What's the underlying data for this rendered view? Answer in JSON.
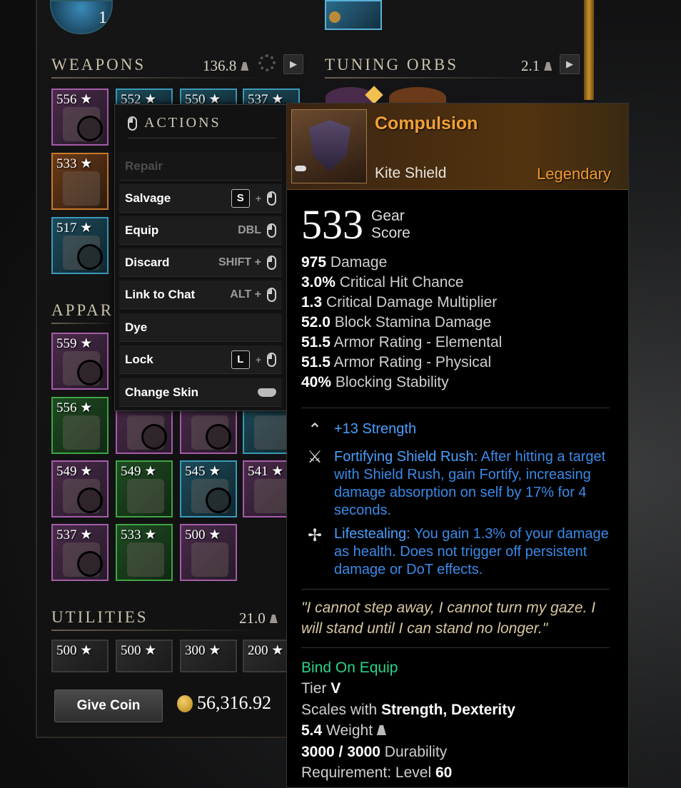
{
  "top": {
    "potion_count": "1"
  },
  "sections": {
    "weapons": {
      "title": "WEAPONS",
      "weight": "136.8"
    },
    "tuning_orbs": {
      "title": "TUNING ORBS",
      "weight": "2.1"
    },
    "apparel": {
      "title": "APPAR"
    },
    "utilities": {
      "title": "UTILITIES",
      "weight": "21.0"
    }
  },
  "weapon_tiles": [
    "556",
    "552",
    "550",
    "537",
    "533",
    "517"
  ],
  "apparel_tiles": [
    "559",
    "556",
    "549",
    "549",
    "545",
    "541",
    "537",
    "533",
    "500"
  ],
  "utility_tiles": [
    "500",
    "500",
    "300",
    "200"
  ],
  "give_coin": "Give Coin",
  "coins": "56,316.92",
  "actions": {
    "title": "ACTIONS",
    "items": [
      {
        "label": "Repair",
        "hint": ""
      },
      {
        "label": "Salvage",
        "key": "S"
      },
      {
        "label": "Equip",
        "hint": "DBL"
      },
      {
        "label": "Discard",
        "hint": "SHIFT +"
      },
      {
        "label": "Link to Chat",
        "hint": "ALT +"
      },
      {
        "label": "Dye",
        "hint": ""
      },
      {
        "label": "Lock",
        "key": "L"
      },
      {
        "label": "Change Skin",
        "hint": ""
      }
    ]
  },
  "tooltip": {
    "name": "Compulsion",
    "type": "Kite Shield",
    "rarity": "Legendary",
    "gear_score": "533",
    "gear_score_label": [
      "Gear",
      "Score"
    ],
    "stats": [
      {
        "value": "975",
        "label": "Damage"
      },
      {
        "value": "3.0%",
        "label": "Critical Hit Chance"
      },
      {
        "value": "1.3",
        "label": "Critical Damage Multiplier"
      },
      {
        "value": "52.0",
        "label": "Block Stamina Damage"
      },
      {
        "value": "51.5",
        "label": "Armor Rating - Elemental"
      },
      {
        "value": "51.5",
        "label": "Armor Rating - Physical"
      },
      {
        "value": "40%",
        "label": "Blocking Stability"
      }
    ],
    "attribute": "+13 Strength",
    "perks": [
      {
        "name": "Fortifying Shield Rush:",
        "desc": "After hitting a target with Shield Rush, gain Fortify, increasing damage absorption on self by 17% for 4 seconds."
      },
      {
        "name": "Lifestealing:",
        "desc": "You gain 1.3% of your damage as health. Does not trigger off persistent damage or DoT effects."
      }
    ],
    "flavor": "\"I cannot step away, I cannot turn my gaze. I will stand until I can stand no longer.\"",
    "bind": "Bind On Equip",
    "tier_label": "Tier",
    "tier": "V",
    "scales_label": "Scales with",
    "scales": "Strength, Dexterity",
    "weight_value": "5.4",
    "weight_label": "Weight",
    "durability_value": "3000 / 3000",
    "durability_label": "Durability",
    "requirement_label": "Requirement:",
    "requirement_level_label": "Level",
    "requirement_level": "60"
  }
}
